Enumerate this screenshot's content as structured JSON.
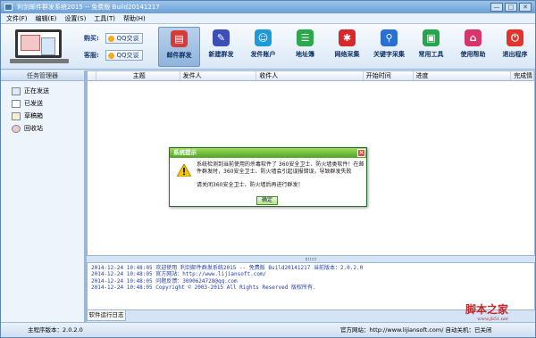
{
  "window": {
    "title": "利剑邮件群发系统2015 -- 免费版   Build20141217",
    "controls": [
      "—",
      "□",
      "✕"
    ]
  },
  "menu": [
    "文件(F)",
    "编辑(E)",
    "设置(S)",
    "工具(T)",
    "帮助(H)"
  ],
  "contact": {
    "buy_label": "购买:",
    "service_label": "客服:",
    "qq_button": "QQ交谈"
  },
  "toolbar": [
    {
      "label": "邮件群发",
      "icon": "mail-list-icon",
      "color": "#d83a3a",
      "glyph": "▤"
    },
    {
      "label": "新建群发",
      "icon": "edit-icon",
      "color": "#3a4fb8",
      "glyph": "✎"
    },
    {
      "label": "发件账户",
      "icon": "user-icon",
      "color": "#1c9bd6",
      "glyph": "☺"
    },
    {
      "label": "地址簿",
      "icon": "address-book-icon",
      "color": "#2aa84a",
      "glyph": "☰"
    },
    {
      "label": "网络采集",
      "icon": "spider-icon",
      "color": "#d8282b",
      "glyph": "✱"
    },
    {
      "label": "关键字采集",
      "icon": "search-icon",
      "color": "#2a6fd6",
      "glyph": "⚲"
    },
    {
      "label": "常用工具",
      "icon": "toolbox-icon",
      "color": "#26a64a",
      "glyph": "▣"
    },
    {
      "label": "使用帮助",
      "icon": "home-icon",
      "color": "#d8366a",
      "glyph": "⌂"
    },
    {
      "label": "退出程序",
      "icon": "power-icon",
      "color": "#e0342c",
      "glyph": "⏻"
    }
  ],
  "sidebar": {
    "header": "任务管理器",
    "items": [
      "正在发送",
      "已发送",
      "草稿箱",
      "回收站"
    ]
  },
  "grid": {
    "columns": [
      "",
      "主题",
      "发件人",
      "收件人",
      "开始时间",
      "进度",
      "完成情"
    ]
  },
  "log": {
    "tab": "软件运行日志",
    "lines": [
      "2014-12-24 10:48:05  欢迎使用 利剑邮件群发系统2015 -- 免费版   Build20141217   当前版本：2.0.2.0",
      "2014-12-24 10:48:05  官方网站：http://www.lijiansoft.com/",
      "2014-12-24 10:48:05  问题反馈：3090624728@qq.com",
      "2014-12-24 10:48:05  Copyright © 2003-2015  All Rights Reserved  版权所有."
    ]
  },
  "status": {
    "version": "主程序版本：2.0.2.0",
    "site": "官方网站：http://www.lijiansoft.com/  自动关机：已关闭"
  },
  "watermark": {
    "main": "脚本之家",
    "sub": "www.jb51.net"
  },
  "dialog": {
    "title": "系统提示",
    "message": "系统检测到当前使用的杀毒软件了 360安全卫士、防火墙类软件！在邮件群发时，360安全卫士、防火墙会引起误报错误，导致群发失败",
    "message2": "请关闭360安全卫士、防火墙后再进行群发！",
    "ok": "确定"
  }
}
